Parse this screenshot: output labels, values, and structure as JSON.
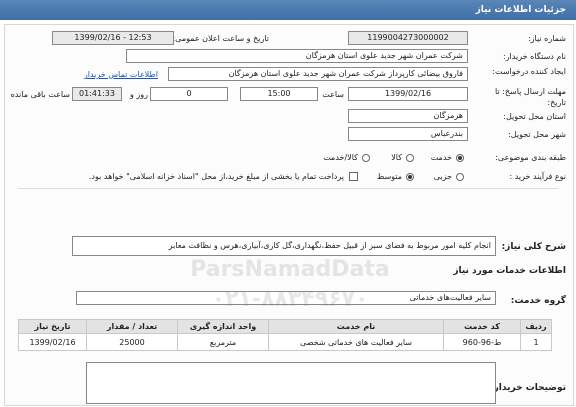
{
  "header": {
    "title": "جزئیات اطلاعات نیاز"
  },
  "fields": {
    "need_number_label": "شماره نیاز:",
    "need_number": "1199004273000002",
    "announce_label": "تاریخ و ساعت اعلان عمومی:",
    "announce_value": "1399/02/16 - 12:53",
    "buyer_org_label": "نام دستگاه خریدار:",
    "buyer_org": "شرکت عمران شهر جدید علوی استان هرمزگان",
    "creator_label": "ایجاد کننده درخواست:",
    "creator": "فاروق  بیضائی کارپرداز شرکت عمران شهر جدید علوی استان هرمزگان",
    "contact_link": "اطلاعات تماس خریدار",
    "deadline_label": "مهلت ارسال پاسخ: تا تاریخ:",
    "deadline_date": "1399/02/16",
    "time_label": "ساعت",
    "deadline_time": "15:00",
    "days_value": "0",
    "days_label": "روز و",
    "remaining_time": "01:41:33",
    "remaining_label": "ساعت باقی مانده",
    "province_label": "استان محل تحویل:",
    "province": "هرمزگان",
    "city_label": "شهر محل تحویل:",
    "city": "بندرعباس",
    "category_label": "طبقه بندی موضوعی:",
    "category_options": [
      "خدمت",
      "کالا",
      "کالا/خدمت"
    ],
    "process_label": "نوع فرآیند خرید :",
    "process_options": [
      "جزیی",
      "متوسط"
    ],
    "payment_note": "پرداخت تمام یا بخشی از مبلغ خرید،از محل \"اسناد خزانه اسلامی\" خواهد بود.",
    "general_desc_label": "شرح کلی نیاز:",
    "general_desc": "انجام کلیه امور مربوط به فضای سبز از قبیل حفظ،نگهداری،گل کاری،آبیاری،هرس و نظافت معابر",
    "services_info_title": "اطلاعات خدمات مورد نیاز",
    "service_group_label": "گروه خدمت:",
    "service_group": "سایر فعالیت‌های خدماتی",
    "buyer_notes_label": "توضیحات خریدار:"
  },
  "table": {
    "headers": [
      "ردیف",
      "کد خدمت",
      "نام خدمت",
      "واحد اندازه گیری",
      "تعداد / مقدار",
      "تاریخ نیاز"
    ],
    "rows": [
      [
        "1",
        "ط-96-960",
        "سایر فعالیت های خدماتی شخصی",
        "مترمربع",
        "25000",
        "1399/02/16"
      ]
    ]
  },
  "watermark": {
    "line1": "ParsNamadData",
    "line2": "۰۲۱-۸۸۳۴۹۶۷۰"
  }
}
